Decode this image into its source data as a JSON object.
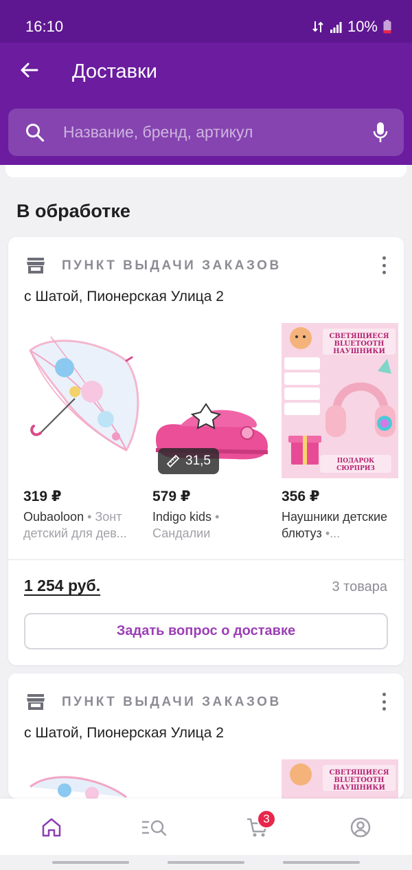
{
  "status_bar": {
    "time": "16:10",
    "battery": "10%"
  },
  "header": {
    "title": "Доставки"
  },
  "search": {
    "placeholder": "Название, бренд, артикул"
  },
  "section": {
    "title": "В обработке"
  },
  "cards": [
    {
      "pickup_label": "ПУНКТ ВЫДАЧИ ЗАКАЗОВ",
      "address": "с Шатой, Пионерская Улица 2",
      "products": [
        {
          "price": "319 ₽",
          "brand": "Oubaoloon",
          "category": "Зонт детский для дев..."
        },
        {
          "price": "579 ₽",
          "brand": "Indigo kids",
          "category": "Сандалии",
          "size": "31,5"
        },
        {
          "price": "356 ₽",
          "brand": "Наушники детские блютуз",
          "category": "..."
        }
      ],
      "total": "1 254 руб.",
      "item_count": "3 товара",
      "ask_button": "Задать вопрос о доставке"
    },
    {
      "pickup_label": "ПУНКТ ВЫДАЧИ ЗАКАЗОВ",
      "address": "с Шатой, Пионерская Улица 2"
    }
  ],
  "headphones_image": {
    "title_line1": "СВЕТЯЩИЕСЯ",
    "title_line2": "BLUETOOTH",
    "title_line3": "НАУШНИКИ",
    "gift_line1": "ПОДАРОК",
    "gift_line2": "СЮРПРИЗ"
  },
  "bottom_nav": {
    "cart_badge": "3"
  },
  "icons": [
    "back-arrow-icon",
    "search-icon",
    "mic-icon",
    "store-icon",
    "more-vertical-icon",
    "ruler-icon",
    "home-icon",
    "catalog-search-icon",
    "cart-icon",
    "profile-icon"
  ],
  "colors": {
    "header": "#6b1c9f",
    "status_bar": "#5e1791",
    "accent": "#9b3fb5",
    "badge": "#e8274b"
  }
}
